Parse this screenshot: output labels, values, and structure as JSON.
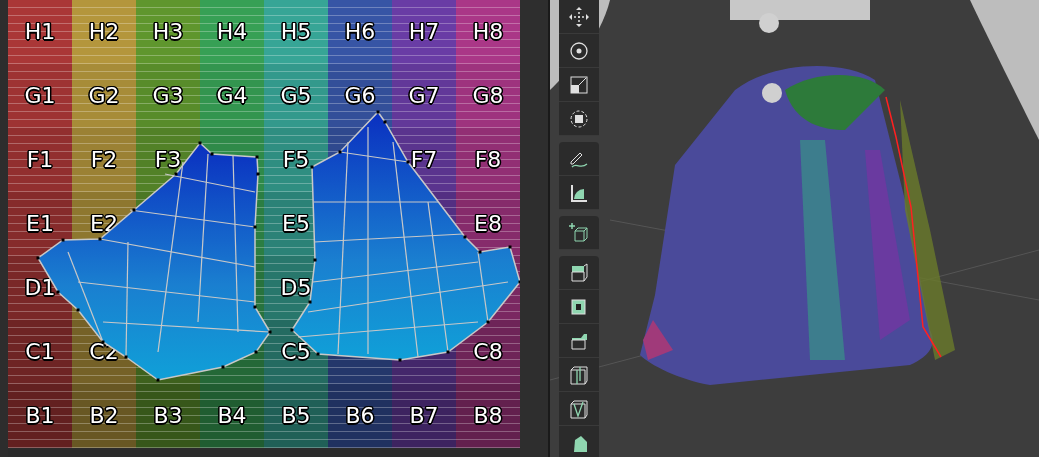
{
  "uv_editor": {
    "grid": {
      "rows": [
        {
          "cells": [
            "H1",
            "H2",
            "H3",
            "H4",
            "H5",
            "H6",
            "H7",
            "H8"
          ]
        },
        {
          "cells": [
            "G1",
            "G2",
            "G3",
            "G4",
            "G5",
            "G6",
            "G7",
            "G8"
          ]
        },
        {
          "cells": [
            "F1",
            "F2",
            "F3",
            null,
            "F5",
            null,
            "F7",
            "F8"
          ]
        },
        {
          "cells": [
            "E1",
            "E2",
            null,
            null,
            "E5",
            null,
            null,
            "E8"
          ]
        },
        {
          "cells": [
            "D1",
            null,
            null,
            null,
            "D5",
            null,
            null,
            null
          ]
        },
        {
          "cells": [
            "C1",
            "C2",
            null,
            null,
            "C5",
            null,
            null,
            "C8"
          ]
        },
        {
          "cells": [
            "B1",
            "B2",
            "B3",
            "B4",
            "B5",
            "B6",
            "B7",
            "B8"
          ]
        }
      ]
    }
  }
}
